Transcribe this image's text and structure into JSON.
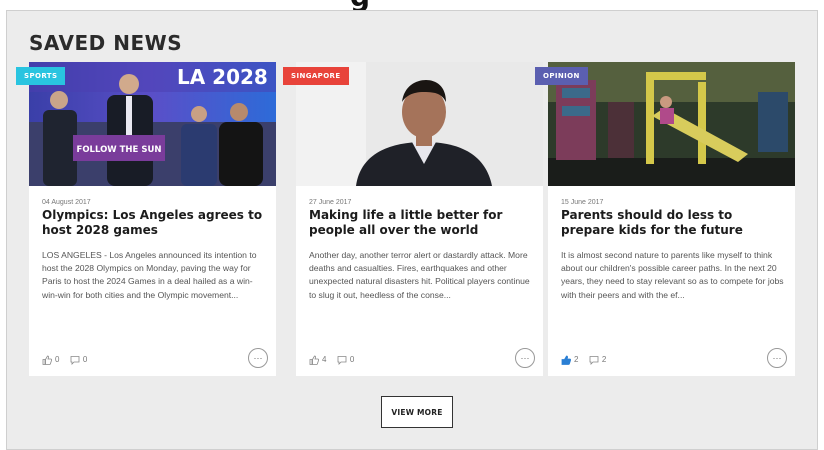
{
  "section_title": "SAVED NEWS",
  "view_more_label": "VIEW MORE",
  "more_button_label": "···",
  "cards": [
    {
      "category": "SPORTS",
      "category_color": "#29c4e0",
      "image_text": "LA 2028",
      "sign_text": "FOLLOW THE SUN",
      "date": "04 August 2017",
      "title": "Olympics: Los Angeles agrees to host 2028 games",
      "excerpt": "LOS ANGELES - Los Angeles announced its intention to host the 2028 Olympics on Monday, paving the way for Paris to host the 2024 Games in a deal hailed as a win-win-win for both cities and the Olympic movement...",
      "likes": "0",
      "comments": "0",
      "liked": false
    },
    {
      "category": "SINGAPORE",
      "category_color": "#e8433a",
      "date": "27 June 2017",
      "title": "Making life a little better for people all over the world",
      "excerpt": "Another day, another terror alert or dastardly attack. More deaths and casualties. Fires, earthquakes and other unexpected natural disasters hit. Political players continue to slug it out, heedless of the conse...",
      "likes": "4",
      "comments": "0",
      "liked": false
    },
    {
      "category": "OPINION",
      "category_color": "#5b5fb0",
      "date": "15 June 2017",
      "title": "Parents should do less to prepare kids for the future",
      "excerpt": "It is almost second nature to parents like myself to think about our children's possible career paths. In the next 20 years, they need to stay relevant so as to compete for jobs with their peers and with the ef...",
      "likes": "2",
      "comments": "2",
      "liked": true
    }
  ],
  "colors": {
    "panel_bg": "#ececec",
    "like_active": "#2a7fd4"
  },
  "icons": [
    "thumbs-up-icon",
    "comment-icon",
    "more-icon"
  ]
}
